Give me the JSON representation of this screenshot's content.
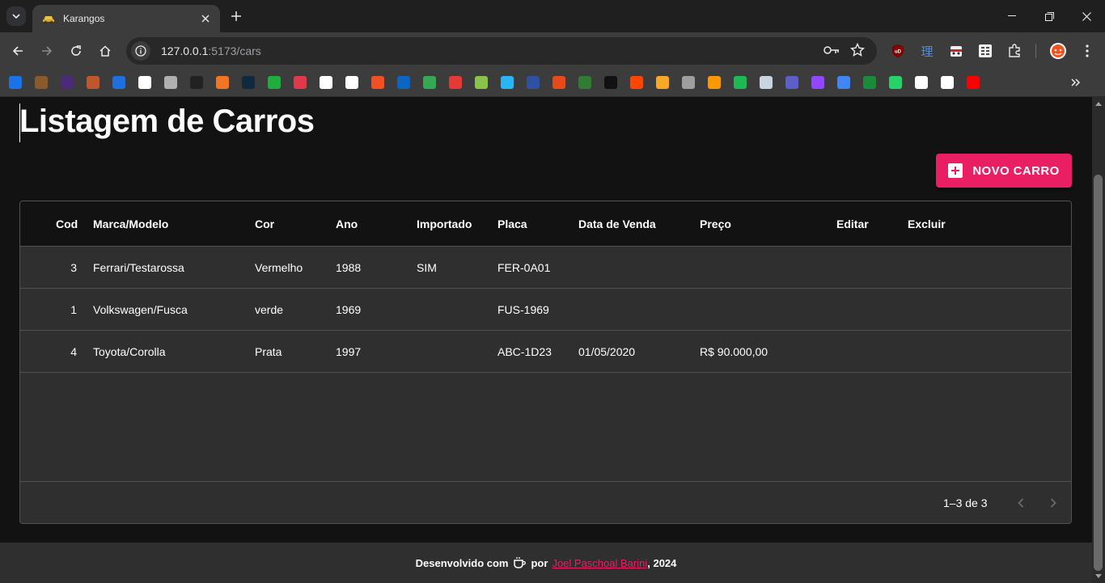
{
  "browser": {
    "tab_title": "Karangos",
    "url_host": "127.0.0.1",
    "url_rest": ":5173/cars",
    "colors": {
      "titlebar": "#1f1f1f",
      "toolbar": "#3c3c3c",
      "accent": "#e91e63"
    }
  },
  "bookmarks": [
    {
      "icon": "99-icon",
      "color": "#1a73e8"
    },
    {
      "icon": "hat-icon",
      "color": "#8b5a2b"
    },
    {
      "icon": "w-icon",
      "color": "#4b2a7a"
    },
    {
      "icon": "cup-icon",
      "color": "#c0562c"
    },
    {
      "icon": "c-icon",
      "color": "#1f6fe0"
    },
    {
      "icon": "openai-icon",
      "color": "#ffffff"
    },
    {
      "icon": "cat-icon",
      "color": "#b0b0b0"
    },
    {
      "icon": "feather-icon",
      "color": "#222222"
    },
    {
      "icon": "crunchyroll-icon",
      "color": "#f47521"
    },
    {
      "icon": "prime-icon",
      "color": "#0f2a3f"
    },
    {
      "icon": "frog-icon",
      "color": "#1fae3b"
    },
    {
      "icon": "a-icon",
      "color": "#e03a4a"
    },
    {
      "icon": "github-icon",
      "color": "#ffffff"
    },
    {
      "icon": "google-icon",
      "color": "#ffffff"
    },
    {
      "icon": "microsoft-icon",
      "color": "#f25022"
    },
    {
      "icon": "linkedin-icon",
      "color": "#0a66c2"
    },
    {
      "icon": "book-icon",
      "color": "#34a853"
    },
    {
      "icon": "k-icon",
      "color": "#e53935"
    },
    {
      "icon": "globe-icon",
      "color": "#8bc34a"
    },
    {
      "icon": "chat-icon",
      "color": "#29b6f6"
    },
    {
      "icon": "mal-icon",
      "color": "#2e51a2"
    },
    {
      "icon": "flower-icon",
      "color": "#e64a19"
    },
    {
      "icon": "cards-icon",
      "color": "#2e7d32"
    },
    {
      "icon": "mc-icon",
      "color": "#111111"
    },
    {
      "icon": "reddit-icon",
      "color": "#ff4500"
    },
    {
      "icon": "s-icon",
      "color": "#f9a825"
    },
    {
      "icon": "earth-icon",
      "color": "#9e9e9e"
    },
    {
      "icon": "bulb-icon",
      "color": "#ff9800"
    },
    {
      "icon": "spotify-icon",
      "color": "#1db954"
    },
    {
      "icon": "steam-icon",
      "color": "#c7d5e0"
    },
    {
      "icon": "teams-icon",
      "color": "#5b5fc7"
    },
    {
      "icon": "twitch-icon",
      "color": "#9146ff"
    },
    {
      "icon": "translate-icon",
      "color": "#4285f4"
    },
    {
      "icon": "w-green-icon",
      "color": "#1b8a3a"
    },
    {
      "icon": "whatsapp-icon",
      "color": "#25d366"
    },
    {
      "icon": "wikipedia-icon",
      "color": "#ffffff"
    },
    {
      "icon": "fw-icon",
      "color": "#ffffff"
    },
    {
      "icon": "youtube-icon",
      "color": "#ff0000"
    }
  ],
  "page": {
    "title": "Listagem de Carros",
    "new_button": "NOVO CARRO"
  },
  "table": {
    "columns": [
      "Cod",
      "Marca/Modelo",
      "Cor",
      "Ano",
      "Importado",
      "Placa",
      "Data de Venda",
      "Preço",
      "Editar",
      "Excluir"
    ],
    "rows": [
      {
        "cod": "3",
        "modelo": "Ferrari/Testarossa",
        "cor": "Vermelho",
        "ano": "1988",
        "importado": "SIM",
        "placa": "FER-0A01",
        "data": "",
        "preco": ""
      },
      {
        "cod": "1",
        "modelo": "Volkswagen/Fusca",
        "cor": "verde",
        "ano": "1969",
        "importado": "",
        "placa": "FUS-1969",
        "data": "",
        "preco": ""
      },
      {
        "cod": "4",
        "modelo": "Toyota/Corolla",
        "cor": "Prata",
        "ano": "1997",
        "importado": "",
        "placa": "ABC-1D23",
        "data": "01/05/2020",
        "preco": "R$ 90.000,00"
      }
    ],
    "pagination": "1–3 de 3"
  },
  "footer": {
    "prefix": "Desenvolvido com",
    "by": "por",
    "author": "Joel Paschoal Barini",
    "year": ", 2024"
  }
}
